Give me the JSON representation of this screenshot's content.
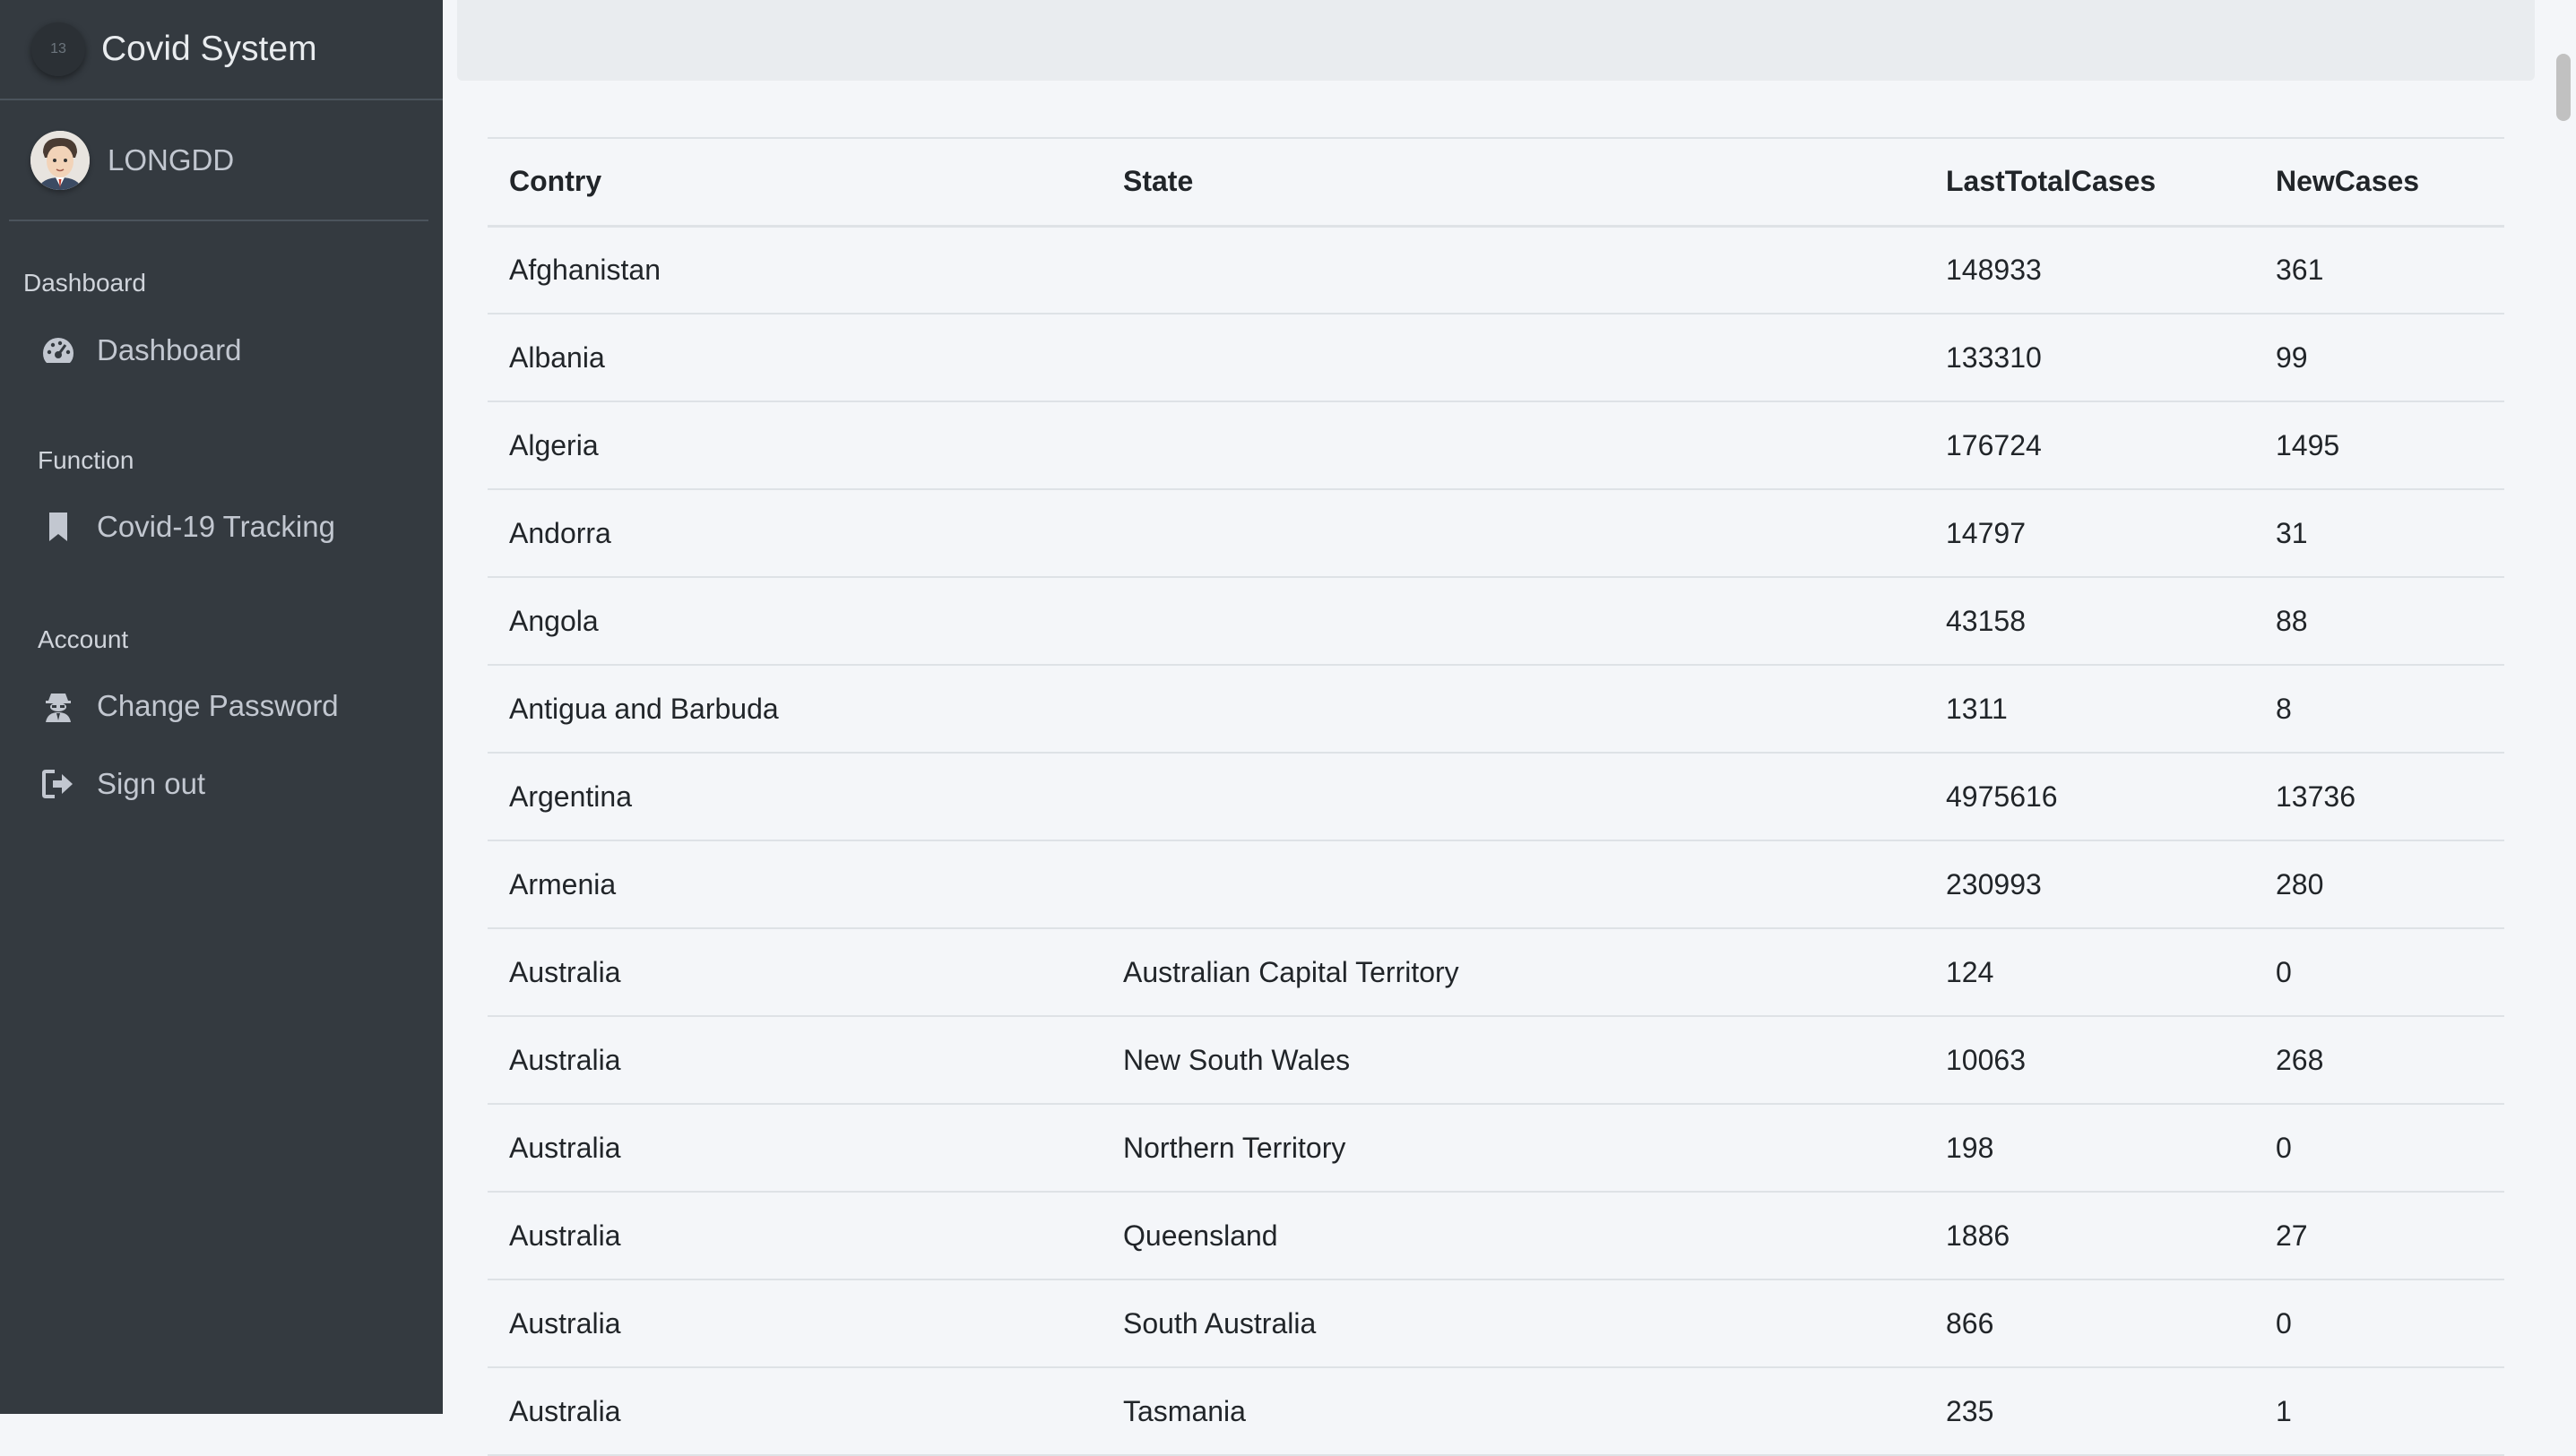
{
  "brand": {
    "title": "Covid System",
    "logo_text": "13"
  },
  "user": {
    "name": "LONGDD"
  },
  "nav": {
    "dashboard_header": "Dashboard",
    "dashboard_item": "Dashboard",
    "function_header": "Function",
    "tracking_item": "Covid-19 Tracking",
    "account_header": "Account",
    "change_password_item": "Change Password",
    "sign_out_item": "Sign out"
  },
  "table": {
    "headers": [
      "Contry",
      "State",
      "LastTotalCases",
      "NewCases"
    ],
    "rows": [
      [
        "Afghanistan",
        "",
        "148933",
        "361"
      ],
      [
        "Albania",
        "",
        "133310",
        "99"
      ],
      [
        "Algeria",
        "",
        "176724",
        "1495"
      ],
      [
        "Andorra",
        "",
        "14797",
        "31"
      ],
      [
        "Angola",
        "",
        "43158",
        "88"
      ],
      [
        "Antigua and Barbuda",
        "",
        "1311",
        "8"
      ],
      [
        "Argentina",
        "",
        "4975616",
        "13736"
      ],
      [
        "Armenia",
        "",
        "230993",
        "280"
      ],
      [
        "Australia",
        "Australian Capital Territory",
        "124",
        "0"
      ],
      [
        "Australia",
        "New South Wales",
        "10063",
        "268"
      ],
      [
        "Australia",
        "Northern Territory",
        "198",
        "0"
      ],
      [
        "Australia",
        "Queensland",
        "1886",
        "27"
      ],
      [
        "Australia",
        "South Australia",
        "866",
        "0"
      ],
      [
        "Australia",
        "Tasmania",
        "235",
        "1"
      ]
    ]
  },
  "colors": {
    "sidebar_bg": "#343a40",
    "content_bg": "#f4f6f9",
    "text": "#212529"
  }
}
